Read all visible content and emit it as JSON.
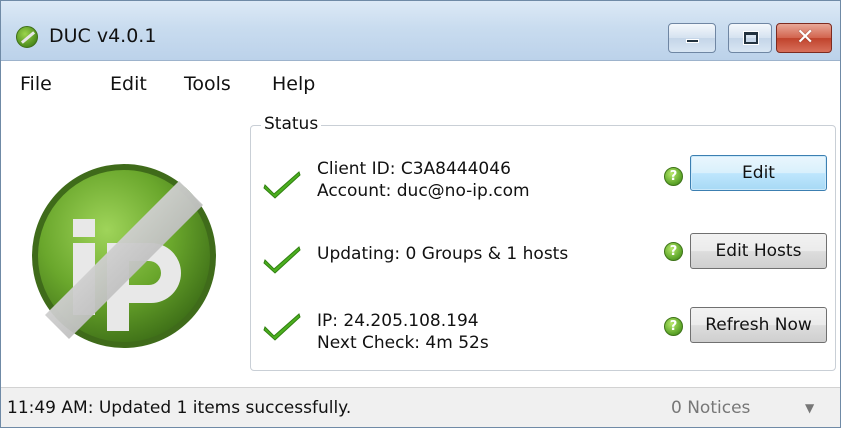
{
  "window": {
    "title": "DUC v4.0.1",
    "controls": {
      "minimize": "minimize",
      "maximize": "maximize",
      "close": "✕"
    }
  },
  "menu": [
    "File",
    "Edit",
    "Tools",
    "Help"
  ],
  "status": {
    "legend": "Status",
    "client_id": "Client ID: C3A8444046",
    "account": "Account: duc@no-ip.com",
    "updating": "Updating: 0 Groups & 1 hosts",
    "ip": "IP: 24.205.108.194",
    "next_check": "Next Check: 4m 52s",
    "help_glyph": "?",
    "buttons": {
      "edit": "Edit",
      "edit_hosts": "Edit Hosts",
      "refresh_now": "Refresh Now"
    }
  },
  "statusbar": {
    "message": "11:49 AM: Updated 1 items successfully.",
    "notices": "0 Notices",
    "caret": "▼"
  },
  "colors": {
    "check_green": "#4caf1f",
    "logo_green": "#6aa72c",
    "accent_blue": "#3c7fb1"
  },
  "icons": [
    "app-logo-icon",
    "check-icon",
    "help-icon",
    "noip-logo"
  ]
}
